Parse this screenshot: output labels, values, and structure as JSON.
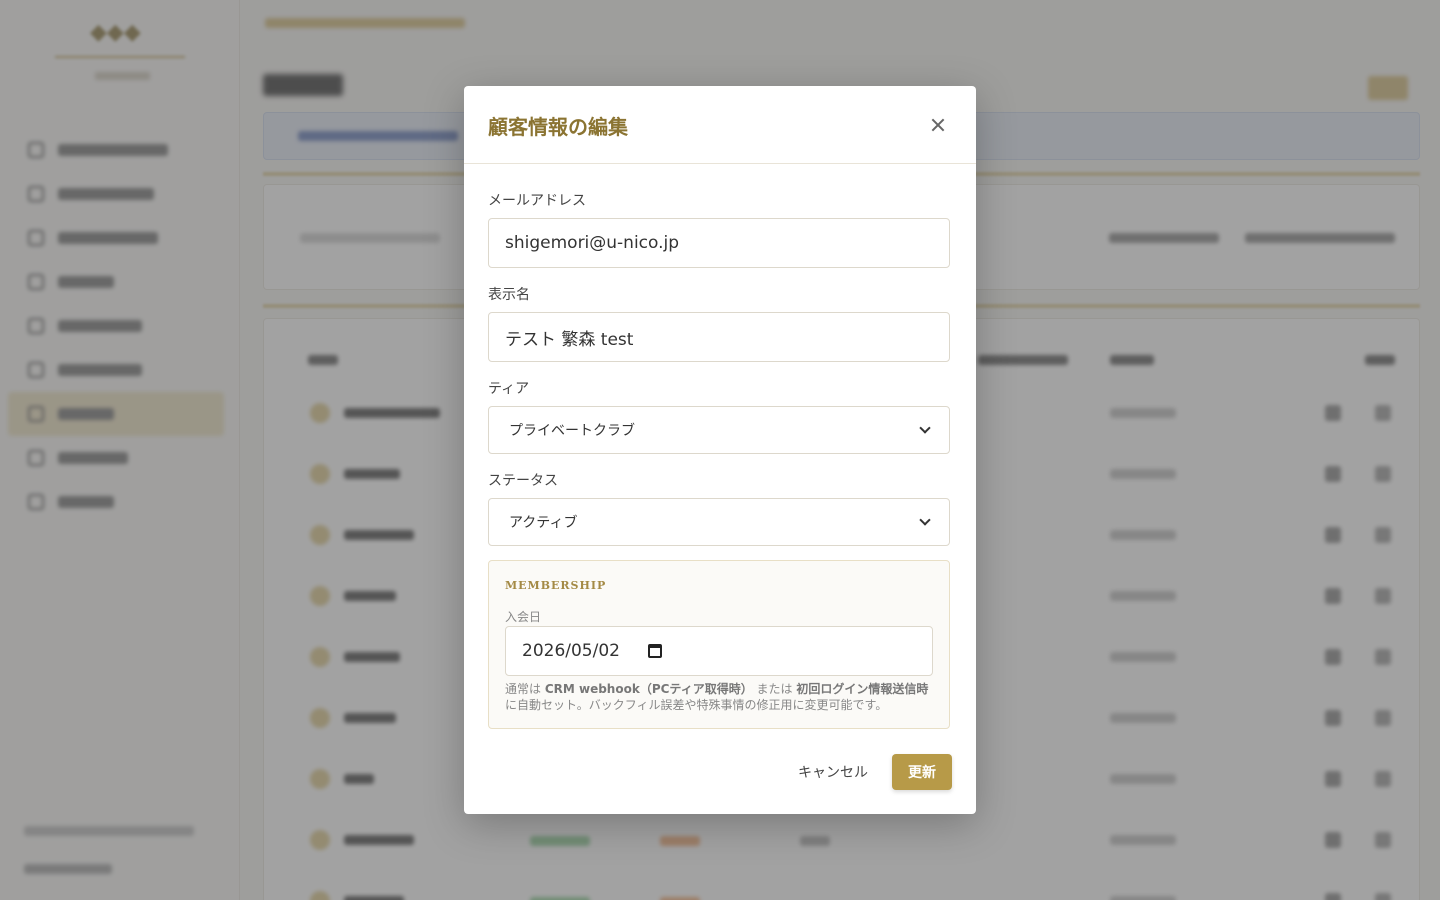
{
  "modal": {
    "title": "顧客情報の編集",
    "email_label": "メールアドレス",
    "email_value": "shigemori@u-nico.jp",
    "display_name_label": "表示名",
    "display_name_value": "テスト 繁森 test",
    "tier_label": "ティア",
    "tier_selected": "プライベートクラブ",
    "status_label": "ステータス",
    "status_selected": "アクティブ",
    "membership": {
      "heading": "MEMBERSHIP",
      "join_date_label": "入会日",
      "join_date_value": "2026/05/02",
      "help_pre": "通常は ",
      "help_b1": "CRM webhook（PCティア取得時）",
      "help_mid": " または ",
      "help_b2": "初回ログイン情報送信時",
      "help_post": " に自動セット。バックフィル誤差や特殊事情の修正用に変更可能です。"
    },
    "cancel_label": "キャンセル",
    "submit_label": "更新"
  },
  "colors": {
    "accent": "#b79a48",
    "title": "#8b7432",
    "overlay": "rgba(70,70,70,0.5)"
  },
  "icons": {
    "close": "close-icon",
    "calendar": "calendar-icon",
    "select": "chevron-down-icon"
  }
}
